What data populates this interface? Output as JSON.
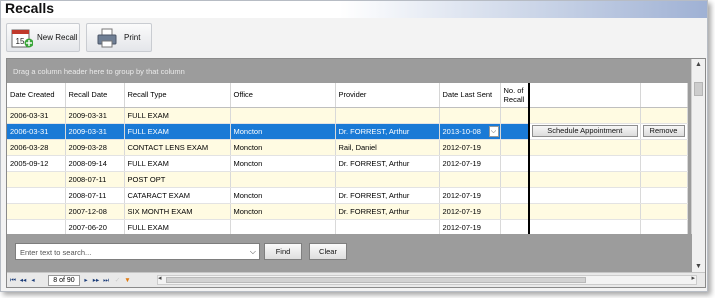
{
  "window": {
    "title": "Recalls"
  },
  "toolbar": {
    "new_recall_label": "New Recall",
    "new_recall_icon": "calendar-icon",
    "new_recall_icon_day": "15",
    "print_label": "Print",
    "print_icon": "printer-icon"
  },
  "grid": {
    "group_hint": "Drag a column header here to group by that column",
    "columns": [
      "Date Created",
      "Recall Date",
      "Recall Type",
      "Office",
      "Provider",
      "Date Last Sent",
      "No. of Recall",
      "",
      ""
    ],
    "rows": [
      {
        "date_created": "2006-03-31",
        "recall_date": "2009-03-31",
        "recall_type": "FULL EXAM",
        "office": "",
        "provider": "",
        "date_last_sent": "",
        "no_of_recall": ""
      },
      {
        "date_created": "2006-03-31",
        "recall_date": "2009-03-31",
        "recall_type": "FULL EXAM",
        "office": "Moncton",
        "provider": "Dr. FORREST, Arthur",
        "date_last_sent": "2013-10-08",
        "no_of_recall": "",
        "selected": true,
        "schedule_label": "Schedule Appointment",
        "remove_label": "Remove"
      },
      {
        "date_created": "2006-03-28",
        "recall_date": "2009-03-28",
        "recall_type": "CONTACT LENS EXAM",
        "office": "Moncton",
        "provider": "Rail, Daniel",
        "date_last_sent": "2012-07-19",
        "no_of_recall": ""
      },
      {
        "date_created": "2005-09-12",
        "recall_date": "2008-09-14",
        "recall_type": "FULL EXAM",
        "office": "Moncton",
        "provider": "Dr. FORREST, Arthur",
        "date_last_sent": "2012-07-19",
        "no_of_recall": ""
      },
      {
        "date_created": "",
        "recall_date": "2008-07-11",
        "recall_type": "POST OPT",
        "office": "",
        "provider": "",
        "date_last_sent": "",
        "no_of_recall": ""
      },
      {
        "date_created": "",
        "recall_date": "2008-07-11",
        "recall_type": "CATARACT EXAM",
        "office": "Moncton",
        "provider": "Dr. FORREST, Arthur",
        "date_last_sent": "2012-07-19",
        "no_of_recall": ""
      },
      {
        "date_created": "",
        "recall_date": "2007-12-08",
        "recall_type": "SIX MONTH EXAM",
        "office": "Moncton",
        "provider": "Dr. FORREST, Arthur",
        "date_last_sent": "2012-07-19",
        "no_of_recall": ""
      },
      {
        "date_created": "",
        "recall_date": "2007-06-20",
        "recall_type": "FULL EXAM",
        "office": "",
        "provider": "",
        "date_last_sent": "2012-07-19",
        "no_of_recall": ""
      }
    ]
  },
  "search": {
    "placeholder": "Enter text to search...",
    "find_label": "Find",
    "clear_label": "Clear"
  },
  "pager": {
    "position": "8 of 90",
    "first": "⏮",
    "prev_page": "◂◂",
    "prev": "◂",
    "next": "▸",
    "next_page": "▸▸",
    "last": "⏭"
  },
  "colors": {
    "selection": "#1a7ad6",
    "alt_row": "#fffbe2",
    "grid_background": "#9c9c9c"
  }
}
